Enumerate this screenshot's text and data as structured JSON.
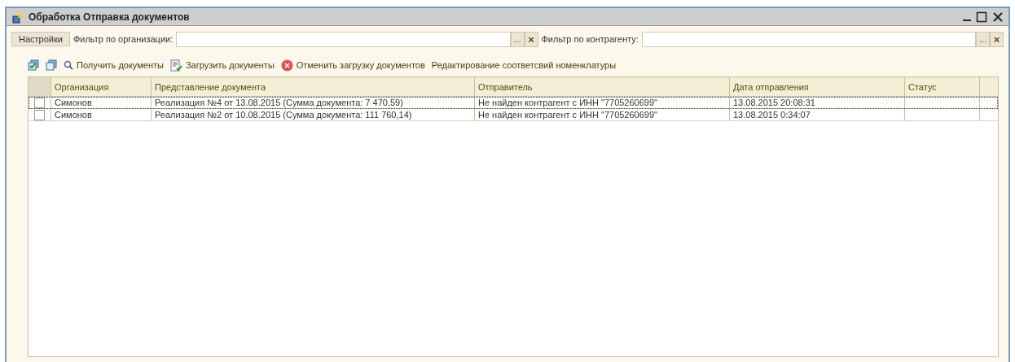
{
  "window": {
    "title": "Обработка  Отправка документов"
  },
  "filters": {
    "settings_button": "Настройки",
    "organization": {
      "label": "Фильтр по организации:",
      "choose": "...",
      "clear": "×"
    },
    "counterparty": {
      "label": "Фильтр по контрагенту:",
      "choose": "...",
      "clear": "×"
    }
  },
  "commands": [
    {
      "kind": "check-all"
    },
    {
      "kind": "uncheck-all"
    },
    {
      "kind": "search",
      "label": "Получить документы"
    },
    {
      "kind": "load",
      "label": "Загрузить документы"
    },
    {
      "kind": "cancel",
      "label": "Отменить загрузку документов"
    },
    {
      "kind": "plain",
      "label": "Редактирование соответсвий номенклатуры"
    }
  ],
  "table": {
    "columns": [
      "Организация",
      "Представление документа",
      "Отправитель",
      "Дата отправления",
      "Статус"
    ],
    "rows": [
      {
        "selected": true,
        "checked": false,
        "cells": [
          "Симонов",
          "Реализация №4 от 13.08.2015 (Сумма документа: 7 470,59)",
          "Не найден контрагент с ИНН \"7705260699\"",
          "13.08.2015 20:08:31"
        ]
      },
      {
        "selected": false,
        "checked": false,
        "cells": [
          "Симонов",
          "Реализация №2 от 10.08.2015 (Сумма документа: 111 760,14)",
          "Не найден контрагент с ИНН \"7705260699\"",
          "13.08.2015 0:34:07"
        ]
      }
    ]
  }
}
